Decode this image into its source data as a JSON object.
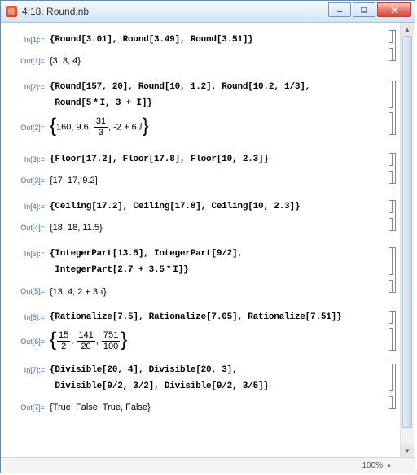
{
  "window": {
    "title": "4.18. Round.nb"
  },
  "status": {
    "zoom": "100%"
  },
  "chart_data": null,
  "cells": {
    "c1": {
      "in_label": "In[1]:=",
      "in_code": "{Round[3.01], Round[3.49], Round[3.51]}",
      "out_label": "Out[1]=",
      "out_code": "{3, 3, 4}"
    },
    "c2": {
      "in_label": "In[2]:=",
      "in_line1": "{Round[157, 20], Round[10, 1.2], Round[10.2, 1/3],",
      "in_line2": " Round[5 * I, 3 + I]}",
      "out_label": "Out[2]=",
      "out_prefix": "160, 9.6, ",
      "frac_num": "31",
      "frac_den": "3",
      "out_suffix": ", -2 + 6 ⅈ"
    },
    "c3": {
      "in_label": "In[3]:=",
      "in_code": "{Floor[17.2], Floor[17.8], Floor[10, 2.3]}",
      "out_label": "Out[3]=",
      "out_code": "{17, 17, 9.2}"
    },
    "c4": {
      "in_label": "In[4]:=",
      "in_code": "{Ceiling[17.2], Ceiling[17.8], Ceiling[10, 2.3]}",
      "out_label": "Out[4]=",
      "out_code": "{18, 18, 11.5}"
    },
    "c5": {
      "in_label": "In[5]:=",
      "in_line1": "{IntegerPart[13.5], IntegerPart[9/2],",
      "in_line2": " IntegerPart[2.7 + 3.5 * I]}",
      "out_label": "Out[5]=",
      "out_code": "{13, 4, 2 + 3 ⅈ}"
    },
    "c6": {
      "in_label": "In[6]:=",
      "in_code": "{Rationalize[7.5], Rationalize[7.05], Rationalize[7.51]}",
      "out_label": "Out[6]=",
      "f1n": "15",
      "f1d": "2",
      "f2n": "141",
      "f2d": "20",
      "f3n": "751",
      "f3d": "100"
    },
    "c7": {
      "in_label": "In[7]:=",
      "in_line1": "{Divisible[20, 4], Divisible[20, 3],",
      "in_line2": " Divisible[9/2, 3/2], Divisible[9/2, 3/5]}",
      "out_label": "Out[7]=",
      "out_code": "{True, False, True, False}"
    }
  }
}
